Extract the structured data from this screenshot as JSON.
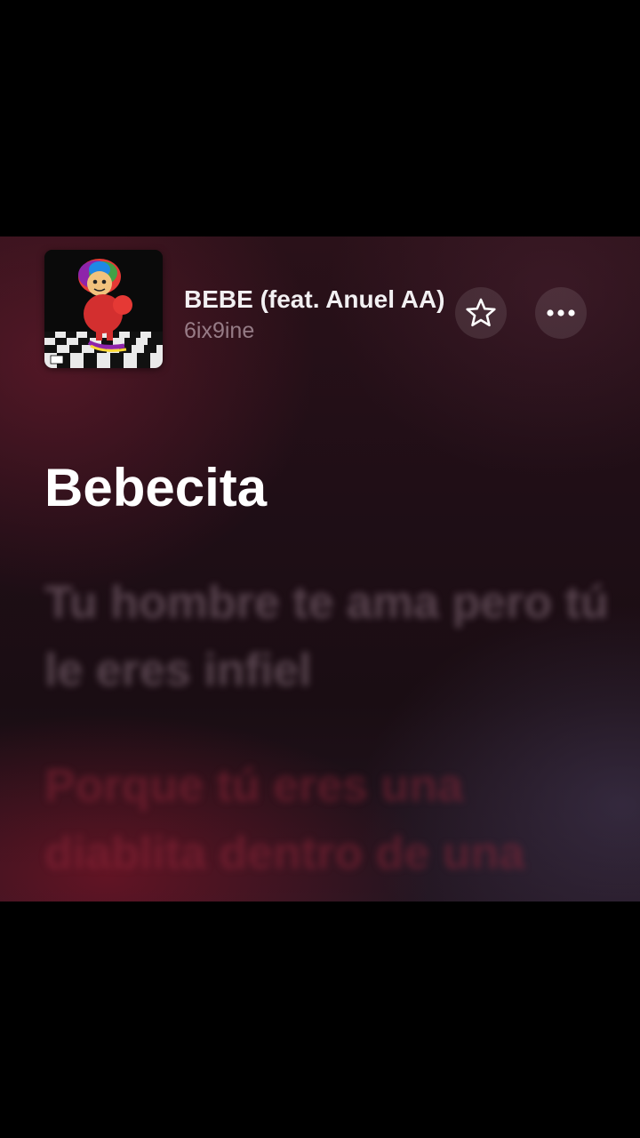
{
  "now_playing": {
    "title": "BEBE (feat. Anuel AA)",
    "artist": "6ix9ine",
    "artwork_icon": "album-artwork"
  },
  "controls": {
    "favorite_icon": "star-icon",
    "more_icon": "ellipsis-icon"
  },
  "lyrics": {
    "current": "Bebecita",
    "next": "Tu hombre te ama pero tú le eres infiel",
    "after": "Porque tú eres una diablita dentro de una"
  },
  "colors": {
    "background_top": "#2a1119",
    "background_bottom": "#221520",
    "lyric_active": "#ffffff",
    "lyric_inactive": "#c8aab9"
  }
}
